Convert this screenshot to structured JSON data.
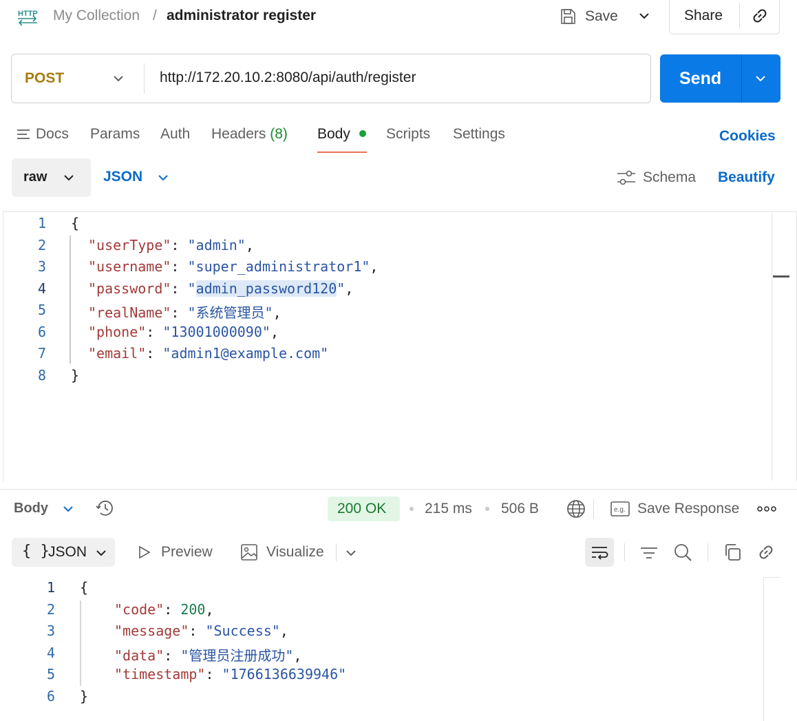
{
  "header": {
    "collection": "My Collection",
    "separator": "/",
    "request_name": "administrator register",
    "save_label": "Save",
    "share_label": "Share"
  },
  "request": {
    "method": "POST",
    "url": "http://172.20.10.2:8080/api/auth/register",
    "send_label": "Send"
  },
  "tabs": {
    "docs": "Docs",
    "params": "Params",
    "auth": "Auth",
    "headers": "Headers",
    "headers_count": "(8)",
    "body": "Body",
    "scripts": "Scripts",
    "settings": "Settings",
    "cookies": "Cookies"
  },
  "body_options": {
    "mode": "raw",
    "language": "JSON",
    "schema_label": "Schema",
    "beautify_label": "Beautify"
  },
  "request_body": {
    "line_numbers": [
      "1",
      "2",
      "3",
      "4",
      "5",
      "6",
      "7",
      "8"
    ],
    "open_brace": "{",
    "close_brace": "}",
    "fields": [
      {
        "key": "\"userType\"",
        "value": "\"admin\"",
        "tail": ","
      },
      {
        "key": "\"username\"",
        "value": "\"super_administrator1\"",
        "tail": ","
      },
      {
        "key": "\"password\"",
        "value_q1": "\"",
        "value_hl": "admin_password120",
        "value_q2": "\"",
        "tail": ","
      },
      {
        "key": "\"realName\"",
        "value": "\"系统管理员\"",
        "tail": ","
      },
      {
        "key": "\"phone\"",
        "value": "\"13001000090\"",
        "tail": ","
      },
      {
        "key": "\"email\"",
        "value": "\"admin1@example.com\"",
        "tail": ""
      }
    ]
  },
  "response": {
    "section_label": "Body",
    "status": "200 OK",
    "time": "215 ms",
    "size": "506 B",
    "save_response_label": "Save Response",
    "format_label": "JSON",
    "format_brace": "{ }",
    "preview_label": "Preview",
    "visualize_label": "Visualize",
    "line_numbers": [
      "1",
      "2",
      "3",
      "4",
      "5",
      "6"
    ],
    "open_brace": "{",
    "close_brace": "}",
    "fields": [
      {
        "key": "\"code\"",
        "value": "200",
        "tail": ","
      },
      {
        "key": "\"message\"",
        "value": "\"Success\"",
        "tail": ","
      },
      {
        "key": "\"data\"",
        "value": "\"管理员注册成功\"",
        "tail": ","
      },
      {
        "key": "\"timestamp\"",
        "value": "\"1766136639946\"",
        "tail": ""
      }
    ]
  },
  "colors": {
    "accent": "#0a7ae6",
    "method": "#a57d10",
    "status_ok": "#1a7a2e",
    "tab_underline": "#e8704e"
  },
  "icons": [
    "http-icon",
    "save-icon",
    "chevron-down-icon",
    "link-icon",
    "docs-icon",
    "schema-icon",
    "history-icon",
    "globe-icon",
    "example-icon",
    "more-icon",
    "play-icon",
    "image-icon",
    "wrap-icon",
    "filter-icon",
    "search-icon",
    "copy-icon"
  ]
}
